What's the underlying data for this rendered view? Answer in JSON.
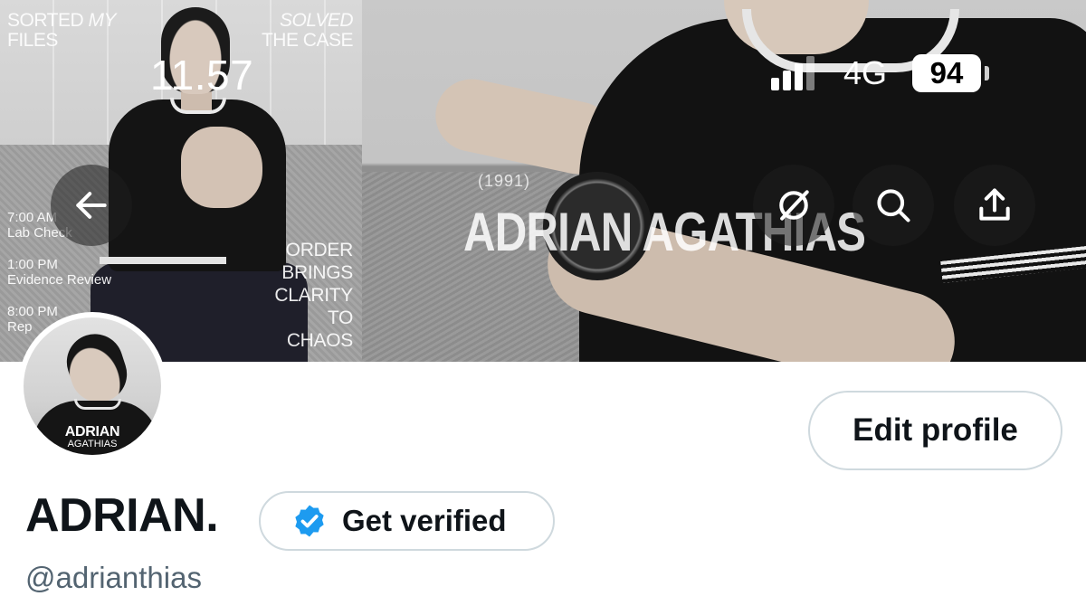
{
  "status_bar": {
    "time": "11.57",
    "network": "4G",
    "battery": "94"
  },
  "banner": {
    "poster": {
      "top_left_line1_a": "SORTED ",
      "top_left_line1_b": "MY",
      "top_left_line2": "FILES",
      "top_right_line1": "SOLVED",
      "top_right_line2": "THE CASE",
      "schedule": [
        {
          "time": "7:00 AM",
          "label": "Lab Check"
        },
        {
          "time": "1:00 PM",
          "label": "Evidence Review"
        },
        {
          "time": "8:00 PM",
          "label": "Rep"
        }
      ],
      "motto": [
        "ORDER",
        "BRINGS",
        "CLARITY",
        "TO",
        "CHAOS"
      ]
    },
    "overlay_year": "(1991)",
    "overlay_name": "ADRIAN AGATHIAS"
  },
  "nav": {
    "back_icon": "arrow-left-icon",
    "grok_icon": "grok-icon",
    "search_icon": "search-icon",
    "share_icon": "share-icon"
  },
  "avatar": {
    "line1": "ADRIAN",
    "line2": "AGATHIAS"
  },
  "profile": {
    "edit_label": "Edit profile",
    "display_name": "ADRIAN.",
    "verify_label": "Get verified",
    "handle": "@adrianthias"
  },
  "colors": {
    "text_primary": "#0f1419",
    "text_secondary": "#536471",
    "border": "#cfd9de",
    "verified_blue": "#1d9bf0"
  }
}
